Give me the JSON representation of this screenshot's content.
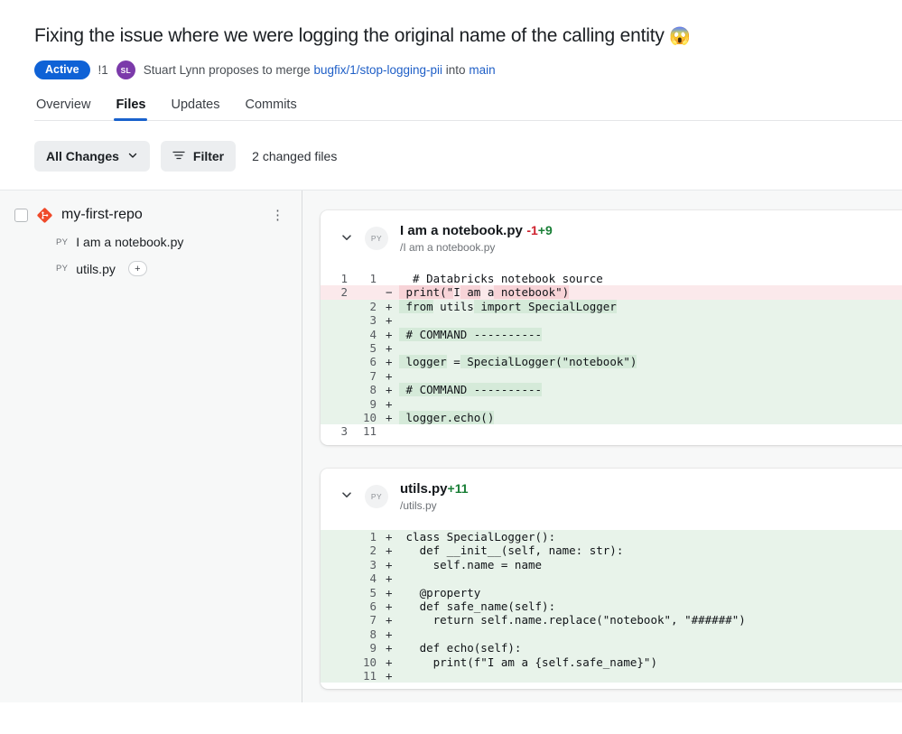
{
  "header": {
    "title": "Fixing the issue where we were logging the original name of the calling entity",
    "title_emoji": "😱",
    "status_badge": "Active",
    "pr_number": "!1",
    "avatar_initials": "SL",
    "author": "Stuart Lynn",
    "action_text_1": "proposes to merge",
    "source_branch": "bugfix/1/stop-logging-pii",
    "action_text_2": "into",
    "target_branch": "main"
  },
  "tabs": [
    {
      "label": "Overview",
      "active": false
    },
    {
      "label": "Files",
      "active": true
    },
    {
      "label": "Updates",
      "active": false
    },
    {
      "label": "Commits",
      "active": false
    }
  ],
  "toolbar": {
    "changes_filter_label": "All Changes",
    "chevron_icon": "chevron-down-icon",
    "filter_label": "Filter",
    "filter_icon": "filter-icon",
    "changed_files_text": "2 changed files"
  },
  "sidebar": {
    "repo_name": "my-first-repo",
    "repo_icon": "git-diamond-icon",
    "checkbox_icon": "checkbox-unchecked",
    "kebab_icon": "kebab-menu-icon",
    "files": [
      {
        "type_tag": "PY",
        "name": "I am a notebook.py",
        "badge": ""
      },
      {
        "type_tag": "PY",
        "name": "utils.py",
        "badge": "+"
      }
    ]
  },
  "diffs": [
    {
      "file_name": "I am a notebook.py",
      "path": "/I am a notebook.py",
      "type_tag": "PY",
      "caret_icon": "chevron-down-icon",
      "deletions": "-1",
      "additions": "+9",
      "lines": [
        {
          "old": "1",
          "new": "1",
          "sign": "",
          "kind": "ctx",
          "segs": [
            {
              "t": "  # Databricks notebook source",
              "hl": false
            }
          ]
        },
        {
          "old": "2",
          "new": "",
          "sign": "−",
          "kind": "del",
          "segs": [
            {
              "t": " print(\"",
              "hl": true
            },
            {
              "t": "I",
              "hl": false
            },
            {
              "t": " am",
              "hl": true
            },
            {
              "t": " a",
              "hl": false
            },
            {
              "t": " notebook\")",
              "hl": true
            }
          ]
        },
        {
          "old": "",
          "new": "2",
          "sign": "+",
          "kind": "add",
          "segs": [
            {
              "t": " from",
              "hl": true
            },
            {
              "t": " utils",
              "hl": false
            },
            {
              "t": " import SpecialLogger",
              "hl": true
            }
          ]
        },
        {
          "old": "",
          "new": "3",
          "sign": "+",
          "kind": "add",
          "segs": [
            {
              "t": "",
              "hl": false
            }
          ]
        },
        {
          "old": "",
          "new": "4",
          "sign": "+",
          "kind": "add",
          "segs": [
            {
              "t": " # COMMAND ----------",
              "hl": true
            }
          ]
        },
        {
          "old": "",
          "new": "5",
          "sign": "+",
          "kind": "add",
          "segs": [
            {
              "t": "",
              "hl": false
            }
          ]
        },
        {
          "old": "",
          "new": "6",
          "sign": "+",
          "kind": "add",
          "segs": [
            {
              "t": " logger",
              "hl": true
            },
            {
              "t": " =",
              "hl": false
            },
            {
              "t": " SpecialLogger(\"notebook\")",
              "hl": true
            }
          ]
        },
        {
          "old": "",
          "new": "7",
          "sign": "+",
          "kind": "add",
          "segs": [
            {
              "t": "",
              "hl": false
            }
          ]
        },
        {
          "old": "",
          "new": "8",
          "sign": "+",
          "kind": "add",
          "segs": [
            {
              "t": " # COMMAND ----------",
              "hl": true
            }
          ]
        },
        {
          "old": "",
          "new": "9",
          "sign": "+",
          "kind": "add",
          "segs": [
            {
              "t": "",
              "hl": false
            }
          ]
        },
        {
          "old": "",
          "new": "10",
          "sign": "+",
          "kind": "add",
          "segs": [
            {
              "t": " logger.echo()",
              "hl": true
            }
          ]
        },
        {
          "old": "3",
          "new": "11",
          "sign": "",
          "kind": "ctx",
          "segs": [
            {
              "t": "",
              "hl": false
            }
          ]
        }
      ]
    },
    {
      "file_name": "utils.py",
      "path": "/utils.py",
      "type_tag": "PY",
      "caret_icon": "chevron-down-icon",
      "deletions": "",
      "additions": "+11",
      "lines": [
        {
          "old": "",
          "new": "1",
          "sign": "+",
          "kind": "add",
          "segs": [
            {
              "t": " class SpecialLogger():",
              "hl": false
            }
          ]
        },
        {
          "old": "",
          "new": "2",
          "sign": "+",
          "kind": "add",
          "segs": [
            {
              "t": "   def __init__(self, name: str):",
              "hl": false
            }
          ]
        },
        {
          "old": "",
          "new": "3",
          "sign": "+",
          "kind": "add",
          "segs": [
            {
              "t": "     self.name = name",
              "hl": false
            }
          ]
        },
        {
          "old": "",
          "new": "4",
          "sign": "+",
          "kind": "add",
          "segs": [
            {
              "t": "",
              "hl": false
            }
          ]
        },
        {
          "old": "",
          "new": "5",
          "sign": "+",
          "kind": "add",
          "segs": [
            {
              "t": "   @property",
              "hl": false
            }
          ]
        },
        {
          "old": "",
          "new": "6",
          "sign": "+",
          "kind": "add",
          "segs": [
            {
              "t": "   def safe_name(self):",
              "hl": false
            }
          ]
        },
        {
          "old": "",
          "new": "7",
          "sign": "+",
          "kind": "add",
          "segs": [
            {
              "t": "     return self.name.replace(\"notebook\", \"######\")",
              "hl": false
            }
          ]
        },
        {
          "old": "",
          "new": "8",
          "sign": "+",
          "kind": "add",
          "segs": [
            {
              "t": "",
              "hl": false
            }
          ]
        },
        {
          "old": "",
          "new": "9",
          "sign": "+",
          "kind": "add",
          "segs": [
            {
              "t": "   def echo(self):",
              "hl": false
            }
          ]
        },
        {
          "old": "",
          "new": "10",
          "sign": "+",
          "kind": "add",
          "segs": [
            {
              "t": "     print(f\"I am a {self.safe_name}\")",
              "hl": false
            }
          ]
        },
        {
          "old": "",
          "new": "11",
          "sign": "+",
          "kind": "add",
          "segs": [
            {
              "t": "",
              "hl": false
            }
          ]
        }
      ]
    }
  ],
  "colors": {
    "accent_blue": "#0f62d6",
    "link_blue": "#1f5fc7",
    "tab_underline": "#1a62cd",
    "avatar_purple": "#7b3aaa",
    "addition_green": "#1a7f37",
    "deletion_red": "#cf222e",
    "repo_icon_red": "#ef4a2a"
  }
}
